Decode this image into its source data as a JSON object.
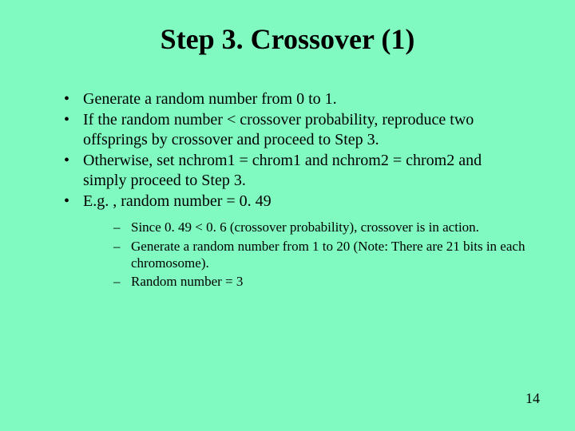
{
  "title": "Step 3. Crossover (1)",
  "bullets": {
    "b0": "Generate a random number from 0 to 1.",
    "b1": "If the random number < crossover probability, reproduce two offsprings by crossover and proceed to Step 3.",
    "b2": "Otherwise, set nchrom1 = chrom1 and nchrom2 = chrom2 and simply proceed to Step 3.",
    "b3": "E.g. , random number = 0. 49"
  },
  "subbullets": {
    "s0": "Since 0. 49 < 0. 6 (crossover probability), crossover is in action.",
    "s1": "Generate a random number from 1 to 20 (Note: There are 21 bits in each chromosome).",
    "s2": "Random number = 3"
  },
  "page_number": "14"
}
